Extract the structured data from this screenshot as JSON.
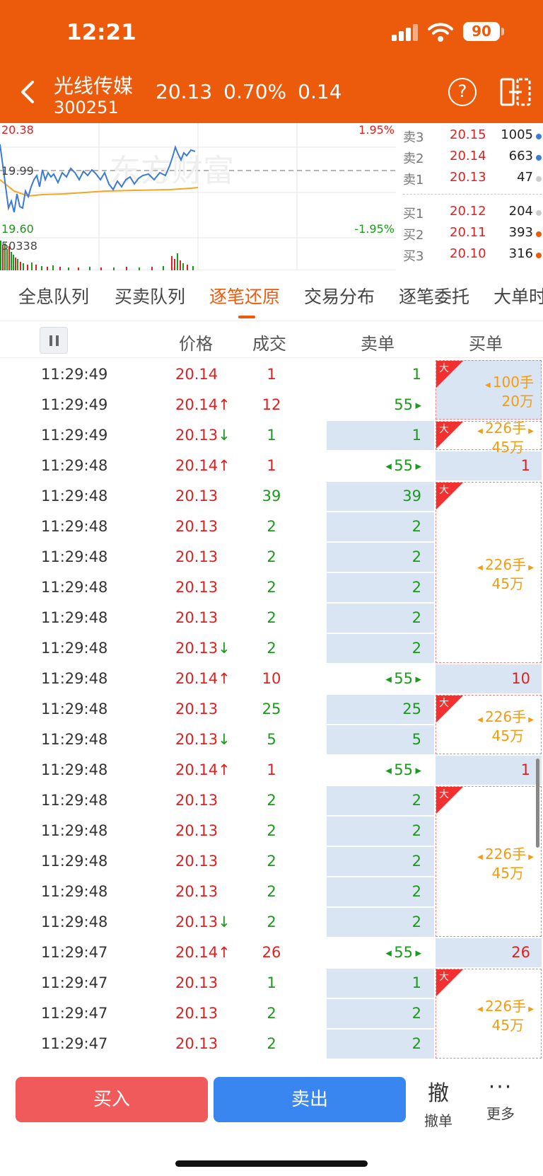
{
  "status_bar": {
    "time": "12:21",
    "battery": "90"
  },
  "header": {
    "name": "光线传媒",
    "code": "300251",
    "price": "20.13",
    "change_pct": "0.70%",
    "change": "0.14"
  },
  "chart": {
    "high": "20.38",
    "mid": "19.99",
    "low": "19.60",
    "high_pct": "1.95%",
    "low_pct": "-1.95%",
    "volume_max": "50338",
    "watermark": "东方财富"
  },
  "order_book": {
    "asks": [
      {
        "label": "卖3",
        "price": "20.15",
        "volume": "1005",
        "dot": "#3a7bd5"
      },
      {
        "label": "卖2",
        "price": "20.14",
        "volume": "663",
        "dot": "#3a7bd5"
      },
      {
        "label": "卖1",
        "price": "20.13",
        "volume": "47",
        "dot": "#cccccc"
      }
    ],
    "bids": [
      {
        "label": "买1",
        "price": "20.12",
        "volume": "204",
        "dot": "#cccccc"
      },
      {
        "label": "买2",
        "price": "20.11",
        "volume": "393",
        "dot": "#ec5a0c"
      },
      {
        "label": "买3",
        "price": "20.10",
        "volume": "316",
        "dot": "#ec5a0c"
      }
    ]
  },
  "tabs": [
    "全息队列",
    "买卖队列",
    "逐笔还原",
    "交易分布",
    "逐笔委托",
    "大单时"
  ],
  "columns": {
    "price": "价格",
    "volume": "成交",
    "sell": "卖单",
    "buy": "买单"
  },
  "trades": [
    {
      "time": "11:29:49",
      "price": "20.14",
      "dir": "",
      "vol": "1",
      "sell": "1"
    },
    {
      "time": "11:29:49",
      "price": "20.14",
      "dir": "↑",
      "vol": "12",
      "sell": "55"
    },
    {
      "time": "11:29:49",
      "price": "20.13",
      "dir": "↓",
      "vol": "1",
      "sell": "1"
    },
    {
      "time": "11:29:48",
      "price": "20.14",
      "dir": "↑",
      "vol": "1",
      "sell": "55",
      "buy": "1"
    },
    {
      "time": "11:29:48",
      "price": "20.13",
      "dir": "",
      "vol": "39",
      "sell": "39"
    },
    {
      "time": "11:29:48",
      "price": "20.13",
      "dir": "",
      "vol": "2",
      "sell": "2"
    },
    {
      "time": "11:29:48",
      "price": "20.13",
      "dir": "",
      "vol": "2",
      "sell": "2"
    },
    {
      "time": "11:29:48",
      "price": "20.13",
      "dir": "",
      "vol": "2",
      "sell": "2"
    },
    {
      "time": "11:29:48",
      "price": "20.13",
      "dir": "",
      "vol": "2",
      "sell": "2"
    },
    {
      "time": "11:29:48",
      "price": "20.13",
      "dir": "↓",
      "vol": "2",
      "sell": "2"
    },
    {
      "time": "11:29:48",
      "price": "20.14",
      "dir": "↑",
      "vol": "10",
      "sell": "55",
      "buy": "10"
    },
    {
      "time": "11:29:48",
      "price": "20.13",
      "dir": "",
      "vol": "25",
      "sell": "25"
    },
    {
      "time": "11:29:48",
      "price": "20.13",
      "dir": "↓",
      "vol": "5",
      "sell": "5"
    },
    {
      "time": "11:29:48",
      "price": "20.14",
      "dir": "↑",
      "vol": "1",
      "sell": "55",
      "buy": "1"
    },
    {
      "time": "11:29:48",
      "price": "20.13",
      "dir": "",
      "vol": "2",
      "sell": "2"
    },
    {
      "time": "11:29:48",
      "price": "20.13",
      "dir": "",
      "vol": "2",
      "sell": "2"
    },
    {
      "time": "11:29:48",
      "price": "20.13",
      "dir": "",
      "vol": "2",
      "sell": "2"
    },
    {
      "time": "11:29:48",
      "price": "20.13",
      "dir": "",
      "vol": "2",
      "sell": "2"
    },
    {
      "time": "11:29:48",
      "price": "20.13",
      "dir": "↓",
      "vol": "2",
      "sell": "2"
    },
    {
      "time": "11:29:47",
      "price": "20.14",
      "dir": "↑",
      "vol": "26",
      "sell": "55",
      "buy": "26"
    },
    {
      "time": "11:29:47",
      "price": "20.13",
      "dir": "",
      "vol": "1",
      "sell": "1"
    },
    {
      "time": "11:29:47",
      "price": "20.13",
      "dir": "",
      "vol": "2",
      "sell": "2"
    },
    {
      "time": "11:29:47",
      "price": "20.13",
      "dir": "",
      "vol": "2",
      "sell": "2"
    }
  ],
  "big_orders": [
    {
      "flag": "大",
      "lots": "100手",
      "amount": "20万"
    },
    {
      "flag": "大",
      "lots": "226手",
      "amount": "45万"
    },
    {
      "flag": "大",
      "lots": "226手",
      "amount": "45万"
    },
    {
      "flag": "大",
      "lots": "226手",
      "amount": "45万"
    },
    {
      "flag": "大",
      "lots": "226手",
      "amount": "45万"
    },
    {
      "flag": "大",
      "lots": "226手",
      "amount": "45万"
    }
  ],
  "bottom": {
    "buy": "买入",
    "sell": "卖出",
    "cancel_glyph": "撤",
    "cancel": "撤单",
    "more_glyph": "···",
    "more": "更多"
  }
}
